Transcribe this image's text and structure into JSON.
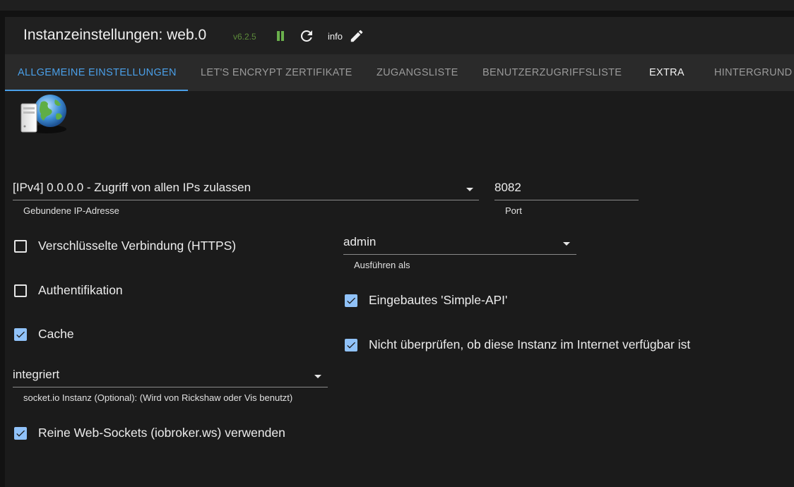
{
  "header": {
    "title": "Instanzeinstellungen: web.0",
    "version": "v6.2.5",
    "log_level": "info"
  },
  "tabs": [
    {
      "label": "ALLGEMEINE EINSTELLUNGEN",
      "active": true
    },
    {
      "label": "LET'S ENCRYPT ZERTIFIKATE"
    },
    {
      "label": "ZUGANGSLISTE"
    },
    {
      "label": "BENUTZERZUGRIFFSLISTE"
    },
    {
      "label": "EXTRA"
    },
    {
      "label": "HINTERGRUND"
    }
  ],
  "form": {
    "bind_ip": {
      "value": "[IPv4] 0.0.0.0 - Zugriff von allen IPs zulassen",
      "label": "Gebundene IP-Adresse"
    },
    "port": {
      "value": "8082",
      "label": "Port"
    },
    "run_as": {
      "value": "admin",
      "label": "Ausführen als"
    },
    "https": {
      "label": "Verschlüsselte Verbindung (HTTPS)",
      "checked": false
    },
    "auth": {
      "label": "Authentifikation",
      "checked": false
    },
    "cache": {
      "label": "Cache",
      "checked": true
    },
    "simple_api": {
      "label": "Eingebautes 'Simple-API'",
      "checked": true
    },
    "no_internet_check": {
      "label": "Nicht überprüfen, ob diese Instanz im Internet verfügbar ist",
      "checked": true
    },
    "socketio": {
      "value": "integriert",
      "label": "socket.io Instanz (Optional): (Wird von Rickshaw oder Vis benutzt)"
    },
    "pure_websockets": {
      "label": "Reine Web-Sockets (iobroker.ws) verwenden",
      "checked": true
    }
  },
  "colors": {
    "accent": "#4a9fe8",
    "checkbox_checked": "#90c2f9",
    "play_pause": "#6ab04c",
    "version": "#5c8a3a"
  }
}
